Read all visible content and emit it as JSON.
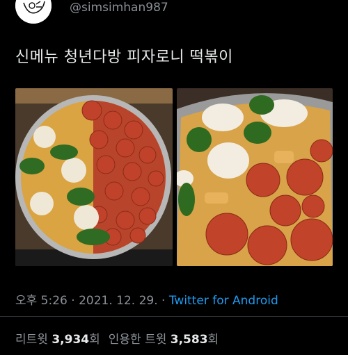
{
  "profile": {
    "handle": "@simsimhan987",
    "avatar_icon": "doodle-avatar-icon"
  },
  "tweet": {
    "text": "신메뉴 청년다방 피자로니 떡볶이"
  },
  "media": {
    "left_photo_icon": "pizza-tteokbokki-pan-top-view-image",
    "right_photo_icon": "pizza-tteokbokki-closeup-image"
  },
  "meta": {
    "time": "오후 5:26",
    "sep1": " · ",
    "date": "2021. 12. 29.",
    "sep2": " · ",
    "source": "Twitter for Android"
  },
  "stats": {
    "retweets_label": "리트윗",
    "retweets_count": "3,934",
    "retweets_unit": "회",
    "quotes_label": "인용한 트윗",
    "quotes_count": "3,583",
    "quotes_unit": "회"
  },
  "colors": {
    "background": "#000000",
    "text": "#e7e9ea",
    "muted": "#8b9197",
    "link": "#1d9bf0"
  }
}
